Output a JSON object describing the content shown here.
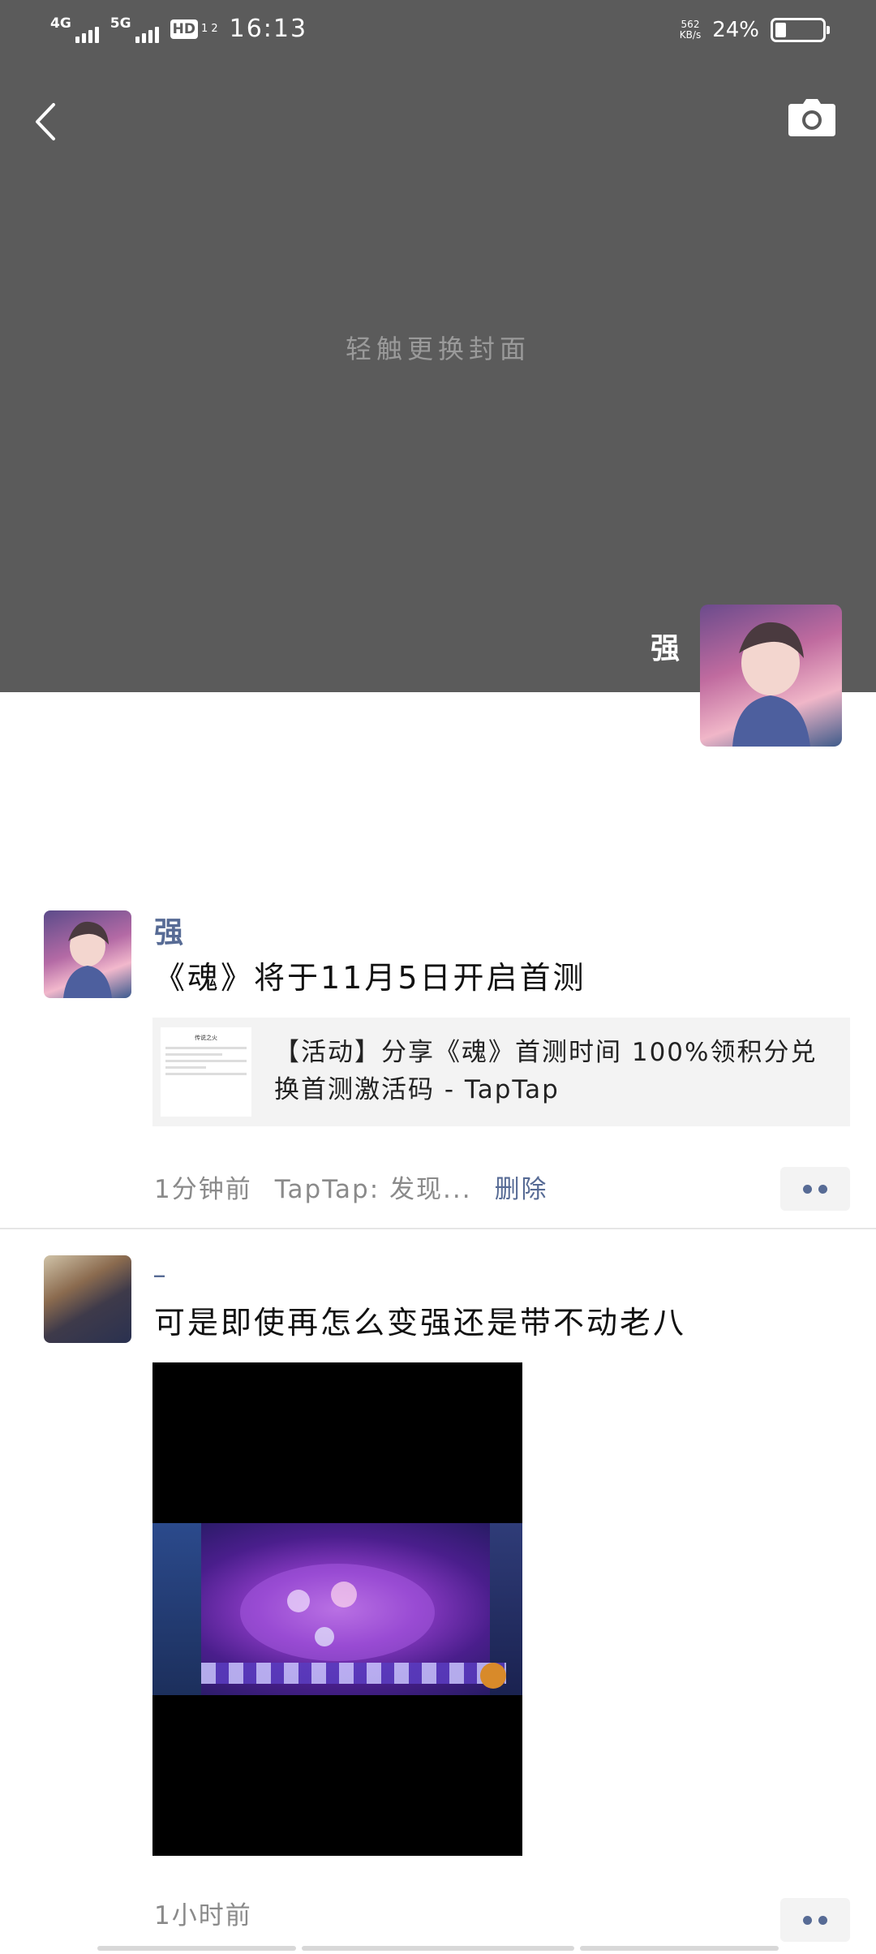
{
  "status_bar": {
    "network_1": "4G",
    "network_2": "5G",
    "hd_badge": "HD",
    "hd_sub": "1 2",
    "time": "16:13",
    "net_speed_value": "562",
    "net_speed_unit": "KB/s",
    "battery_percent": "24%",
    "battery_level": 0.24
  },
  "cover": {
    "hint": "轻触更换封面",
    "profile_name": "强"
  },
  "posts": [
    {
      "author": "强",
      "text": "《魂》将于11月5日开启首测",
      "share_card": {
        "thumb_title": "传说之火",
        "title": "【活动】分享《魂》首测时间 100%领积分兑换首测激活码 - TapTap"
      },
      "time": "1分钟前",
      "source": "TapTap: 发现...",
      "delete_label": "删除"
    },
    {
      "author": "_",
      "text": "可是即使再怎么变强还是带不动老八",
      "time": "1小时前"
    }
  ]
}
